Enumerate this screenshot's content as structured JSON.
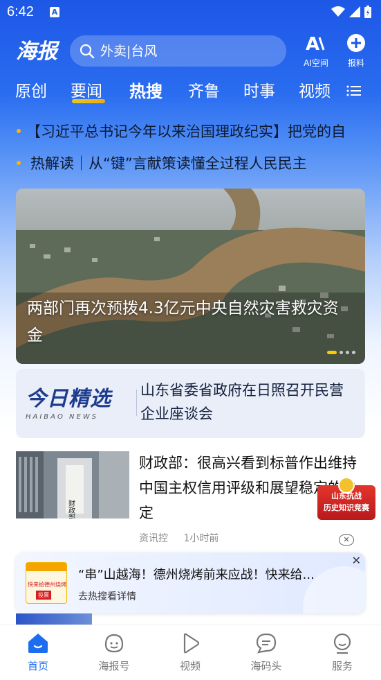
{
  "status_bar": {
    "time": "6:42",
    "notification_icon": "A"
  },
  "header": {
    "logo_text": "海报",
    "search_placeholder": "外卖|台风",
    "ai_label": "AI空间",
    "ai_glyph": "A",
    "report_label": "报料"
  },
  "tabs": [
    {
      "label": "原创"
    },
    {
      "label": "要闻"
    },
    {
      "label": "热搜"
    },
    {
      "label": "齐鲁"
    },
    {
      "label": "时事"
    },
    {
      "label": "视频"
    }
  ],
  "ticker": [
    {
      "text": "【习近平总书记今年以来治国理政纪实】把党的自"
    },
    {
      "text": "热解读｜从“键”言献策读懂全过程人民民主"
    }
  ],
  "hero": {
    "title": "两部门再次预拨4.3亿元中央自然灾害救灾资金"
  },
  "today_pick": {
    "brand_main": "今日精选",
    "brand_sub": "HAIBAO NEWS",
    "title": "山东省委省政府在日照召开民营企业座谈会"
  },
  "news": {
    "title": "财政部：很高兴看到标普作出维持中国主权信用评级和展望稳定的决定",
    "source": "资讯控",
    "time": "1小时前",
    "thumb_sign": "财政部"
  },
  "promo": {
    "line1": "山东抗战",
    "line2": "历史知识竞赛"
  },
  "hot_banner": {
    "title": "“串”山越海！德州烧烤前来应战！快来给...",
    "subtitle": "去热搜看详情",
    "image_line1": "快来给德州烧烤",
    "image_line2": "投票"
  },
  "bottom_nav": [
    {
      "label": "首页",
      "icon": "home-icon"
    },
    {
      "label": "海报号",
      "icon": "smile-icon"
    },
    {
      "label": "视频",
      "icon": "play-icon"
    },
    {
      "label": "海码头",
      "icon": "chat-icon"
    },
    {
      "label": "服务",
      "icon": "service-icon"
    }
  ],
  "colors": {
    "brand_blue": "#1d57e6",
    "active_nav": "#1d6df0",
    "accent_yellow": "#ffc800",
    "promo_red": "#d21f1f"
  }
}
